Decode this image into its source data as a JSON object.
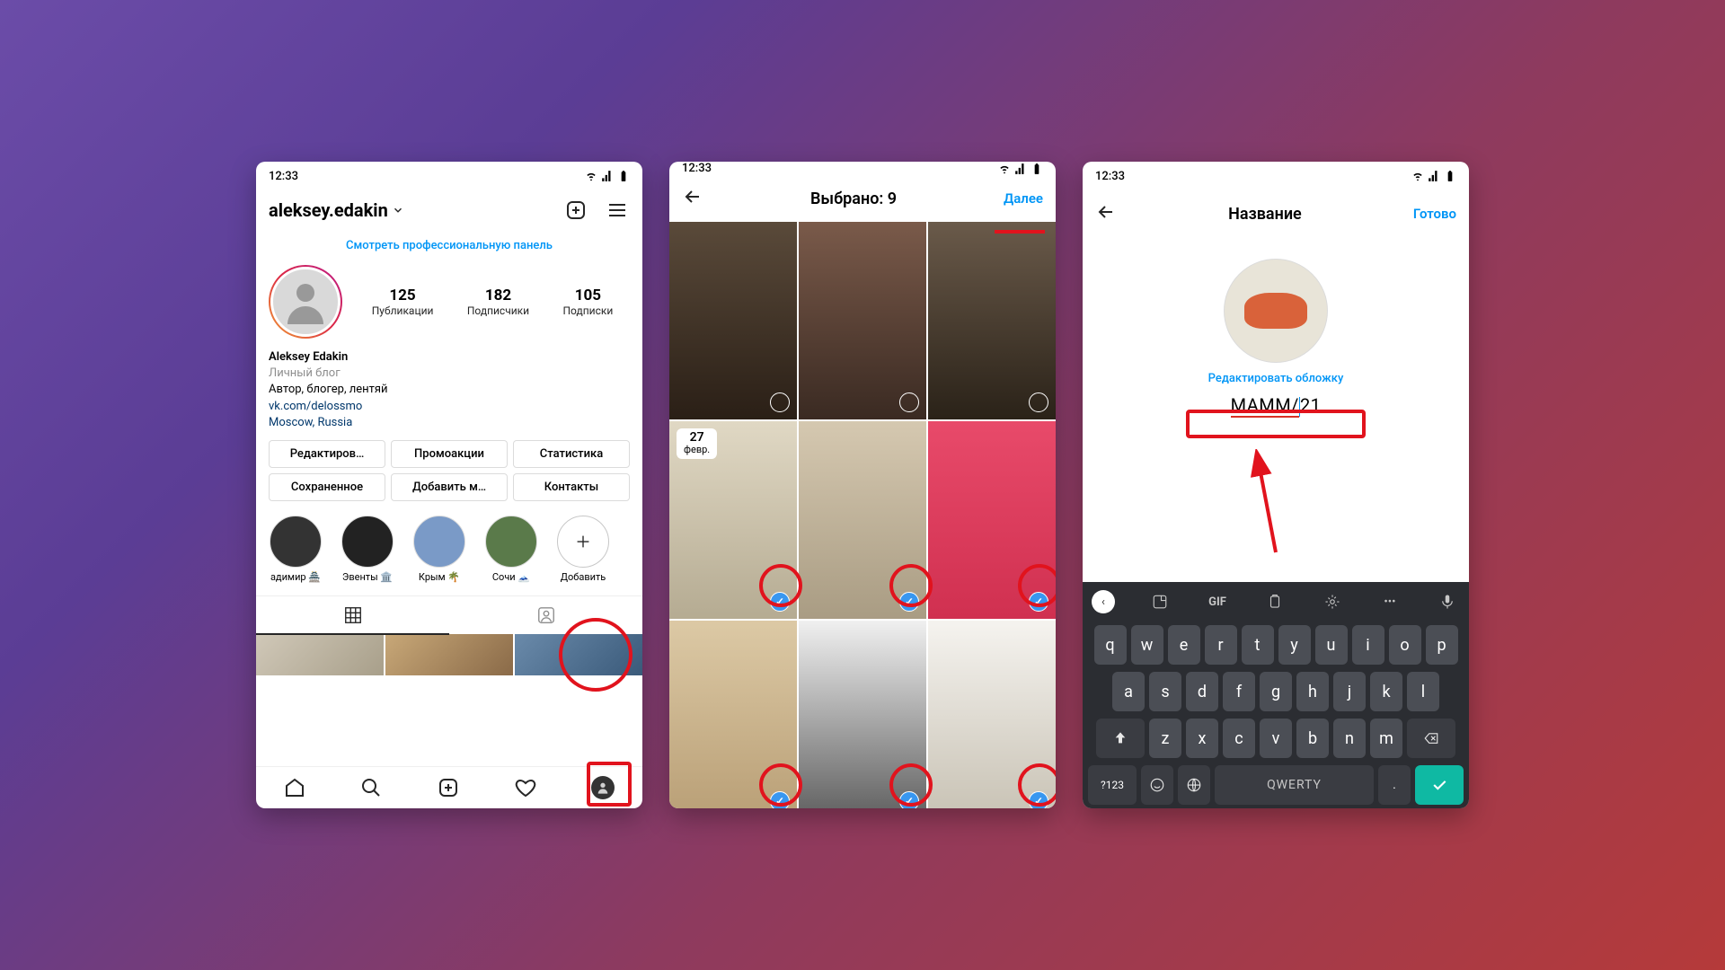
{
  "status": {
    "time": "12:33"
  },
  "screen1": {
    "username": "aleksey.edakin",
    "panel_link": "Смотреть профессиональную панель",
    "stats": {
      "posts": {
        "num": "125",
        "label": "Публикации"
      },
      "followers": {
        "num": "182",
        "label": "Подписчики"
      },
      "following": {
        "num": "105",
        "label": "Подписки"
      }
    },
    "bio": {
      "name": "Aleksey Edakin",
      "category": "Личный блог",
      "desc": "Автор, блогер, лентяй",
      "link": "vk.com/delossmo",
      "location": "Moscow, Russia"
    },
    "buttons": [
      "Редактиров…",
      "Промоакции",
      "Статистика",
      "Сохраненное",
      "Добавить м…",
      "Контакты"
    ],
    "highlights": [
      {
        "label": "адимир 🏯"
      },
      {
        "label": "Эвенты 🏛️"
      },
      {
        "label": "Крым 🌴"
      },
      {
        "label": "Сочи 🗻"
      }
    ],
    "highlight_new": "Добавить"
  },
  "screen2": {
    "title": "Выбрано: 9",
    "next": "Далее",
    "date_badge": {
      "day": "27",
      "month": "февр."
    }
  },
  "screen3": {
    "header": "Название",
    "done": "Готово",
    "edit_cover": "Редактировать обложку",
    "input_value_pre": "МАММ/",
    "input_value_post": "21",
    "keyboard": {
      "row1": [
        "q",
        "w",
        "e",
        "r",
        "t",
        "y",
        "u",
        "i",
        "o",
        "p"
      ],
      "row2": [
        "a",
        "s",
        "d",
        "f",
        "g",
        "h",
        "j",
        "k",
        "l"
      ],
      "row3_mid": [
        "z",
        "x",
        "c",
        "v",
        "b",
        "n",
        "m"
      ],
      "numkey": "?123",
      "space": "QWERTY",
      "gif": "GIF"
    }
  }
}
